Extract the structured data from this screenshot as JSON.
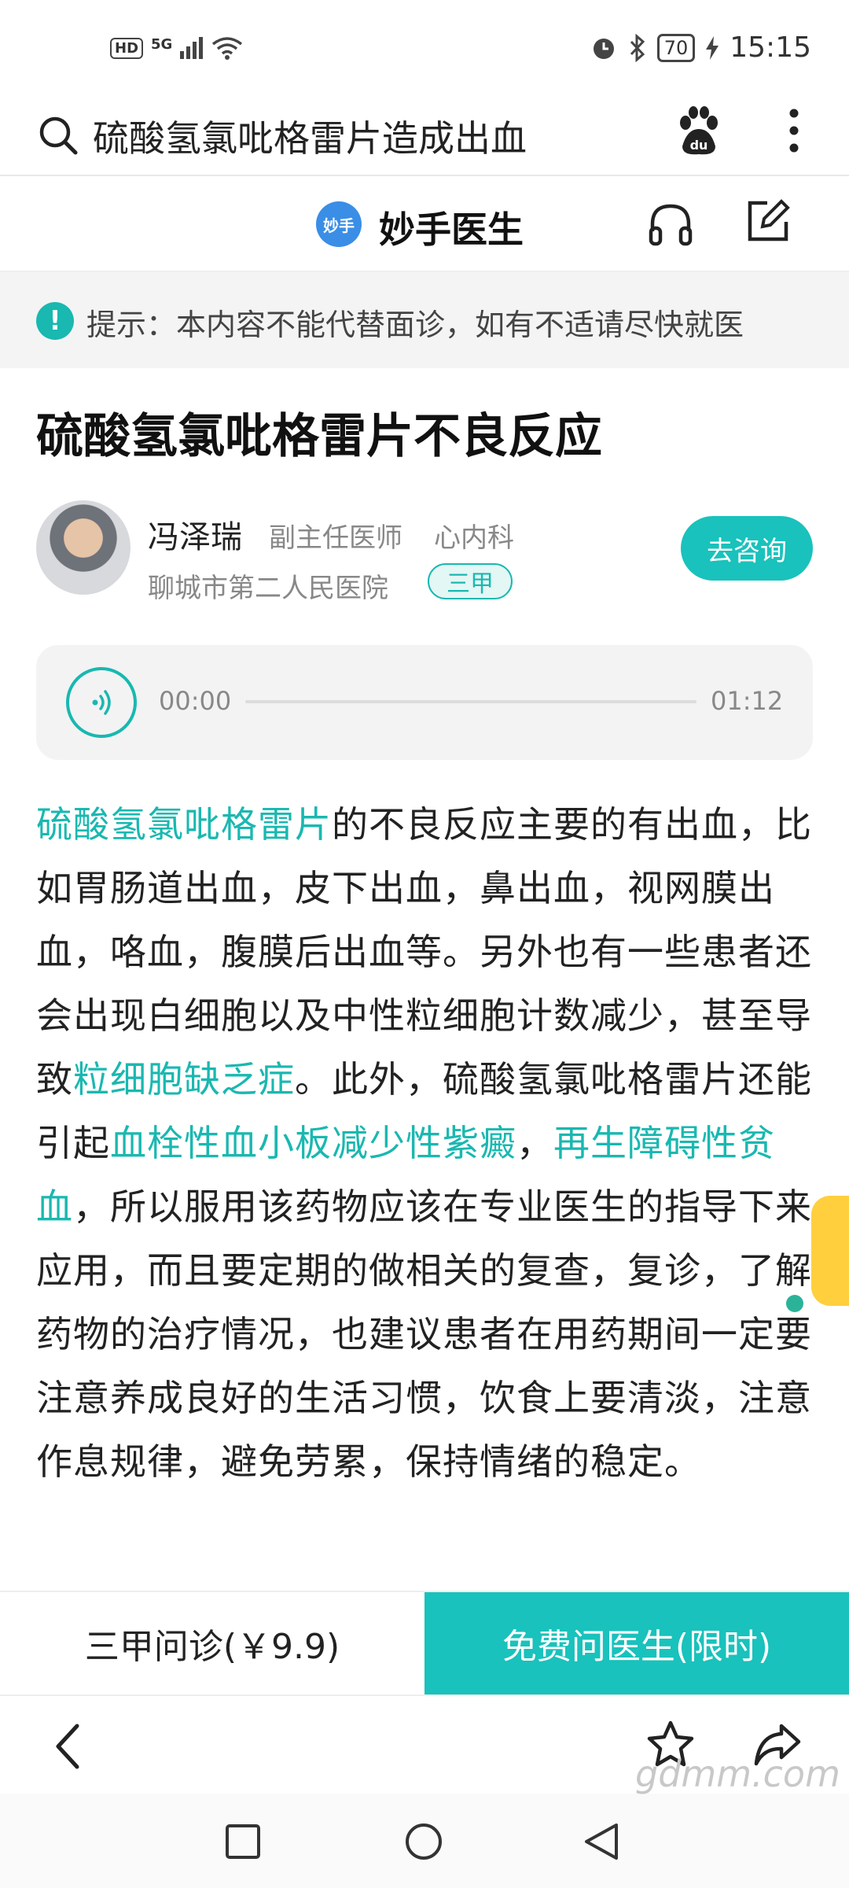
{
  "status_bar": {
    "hd": "HD",
    "network": "5G",
    "battery": "70",
    "time": "15:15"
  },
  "search": {
    "query": "硫酸氢氯吡格雷片造成出血"
  },
  "brand": {
    "logo_text": "妙手",
    "name": "妙手医生"
  },
  "notice": {
    "icon_text": "!",
    "text": "提示：本内容不能代替面诊，如有不适请尽快就医"
  },
  "article": {
    "title": "硫酸氢氯吡格雷片不良反应",
    "body": [
      {
        "text": "硫酸氢氯吡格雷片",
        "link": true
      },
      {
        "text": "的不良反应主要的有出血，比如胃肠道出血，皮下出血，鼻出血，视网膜出血，咯血，腹膜后出血等。另外也有一些患者还会出现白细胞以及中性粒细胞计数减少，甚至导致",
        "link": false
      },
      {
        "text": "粒细胞缺乏症",
        "link": true
      },
      {
        "text": "。此外，硫酸氢氯吡格雷片还能引起",
        "link": false
      },
      {
        "text": "血栓性血小板减少性紫癜",
        "link": true
      },
      {
        "text": "，",
        "link": false
      },
      {
        "text": "再生障碍性贫血",
        "link": true
      },
      {
        "text": "，所以服用该药物应该在专业医生的指导下来应用，而且要定期的做相关的复查，复诊，了解药物的治疗情况，也建议患者在用药期间一定要注意养成良好的生活习惯，饮食上要清淡，注意作息规律，避免劳累，保持情绪的稳定。",
        "link": false
      }
    ]
  },
  "doctor": {
    "name": "冯泽瑞",
    "title": "副主任医师",
    "department": "心内科",
    "hospital": "聊城市第二人民医院",
    "grade": "三甲",
    "consult_button": "去咨询"
  },
  "audio": {
    "current": "00:00",
    "duration": "01:12",
    "progress": 0
  },
  "cta": {
    "left_label": "三甲问诊(￥9.9)",
    "right_label": "免费问医生(限时)"
  },
  "watermark": "gdmm.com",
  "colors": {
    "accent": "#19c2bc",
    "link": "#19b8b0"
  }
}
